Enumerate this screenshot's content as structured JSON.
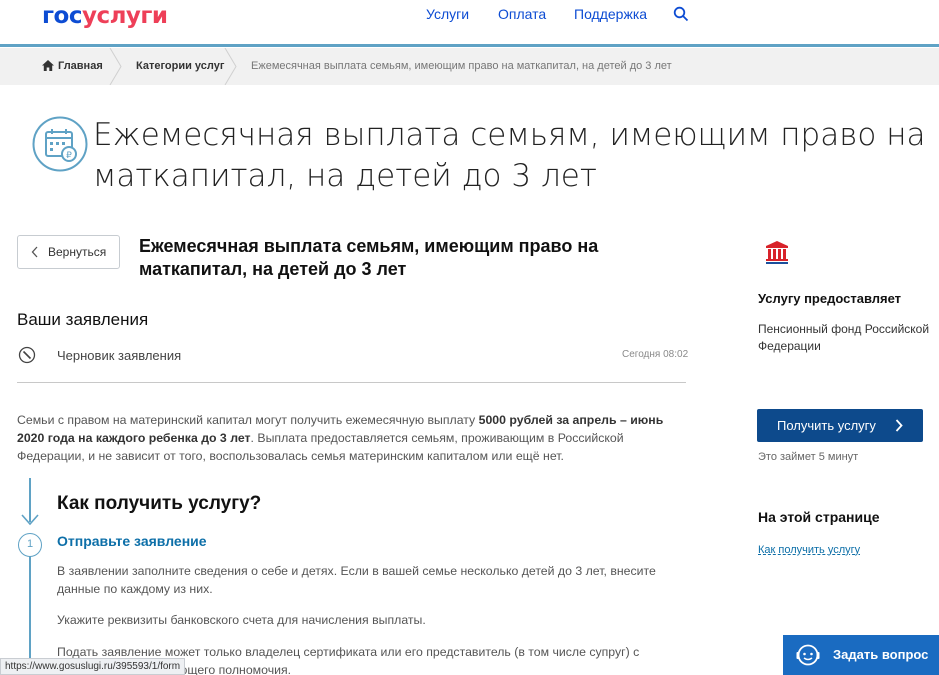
{
  "header": {
    "logo_part1": "гос",
    "logo_part2": "услуги",
    "nav": [
      "Услуги",
      "Оплата",
      "Поддержка"
    ],
    "search_icon": "search-icon",
    "accent_color": "#0d4cd3",
    "logo_red": "#ee3f58"
  },
  "breadcrumbs": {
    "home": "Главная",
    "categories": "Категории услуг",
    "current": "Ежемесячная выплата семьям, имеющим право на маткапитал, на детей до 3 лет"
  },
  "page": {
    "title": "Ежемесячная выплата семьям, имеющим право на маткапитал, на детей до 3 лет",
    "title_icon": "calendar-ruble-icon"
  },
  "main": {
    "back_label": "Вернуться",
    "service_title": "Ежемесячная выплата семьям, имеющим право на маткапитал, на детей до 3 лет",
    "applications_heading": "Ваши заявления",
    "draft_label": "Черновик заявления",
    "draft_time": "Сегодня 08:02",
    "intro_part1": "Семьи с правом на материнский капитал могут получить ежемесячную выплату ",
    "intro_bold": "5000 рублей за апрель – июнь 2020 года на каждого ребенка до 3 лет",
    "intro_part2": ". Выплата предоставляется семьям, проживающим в Российской Федерации, и не зависит от того, воспользовалась семья материнским капиталом или ещё нет.",
    "how_heading": "Как получить услугу?",
    "step_number": "1",
    "step_title": "Отправьте заявление",
    "step_p1": "В заявлении заполните сведения о себе и детях. Если в вашей семье несколько детей до 3 лет, внесите данные по каждому из них.",
    "step_p2": "Укажите реквизиты банковского счета для начисления выплаты.",
    "step_p3": "Подать заявление может только владелец сертификата или его представитель (в том числе супруг) с кумента, подтверждающего полномочия."
  },
  "sidebar": {
    "provides_label": "Услугу предоставляет",
    "provider_name": "Пенсионный фонд Российской Федерации",
    "get_service_label": "Получить услугу",
    "duration": "Это займет 5 минут",
    "on_page_heading": "На этой странице",
    "on_page_link": "Как получить услугу",
    "button_color": "#0d4a8c"
  },
  "status_bar": {
    "url": "https://www.gosuslugi.ru/395593/1/form"
  },
  "ask": {
    "label": "Задать вопрос",
    "color": "#1a6bc1"
  }
}
